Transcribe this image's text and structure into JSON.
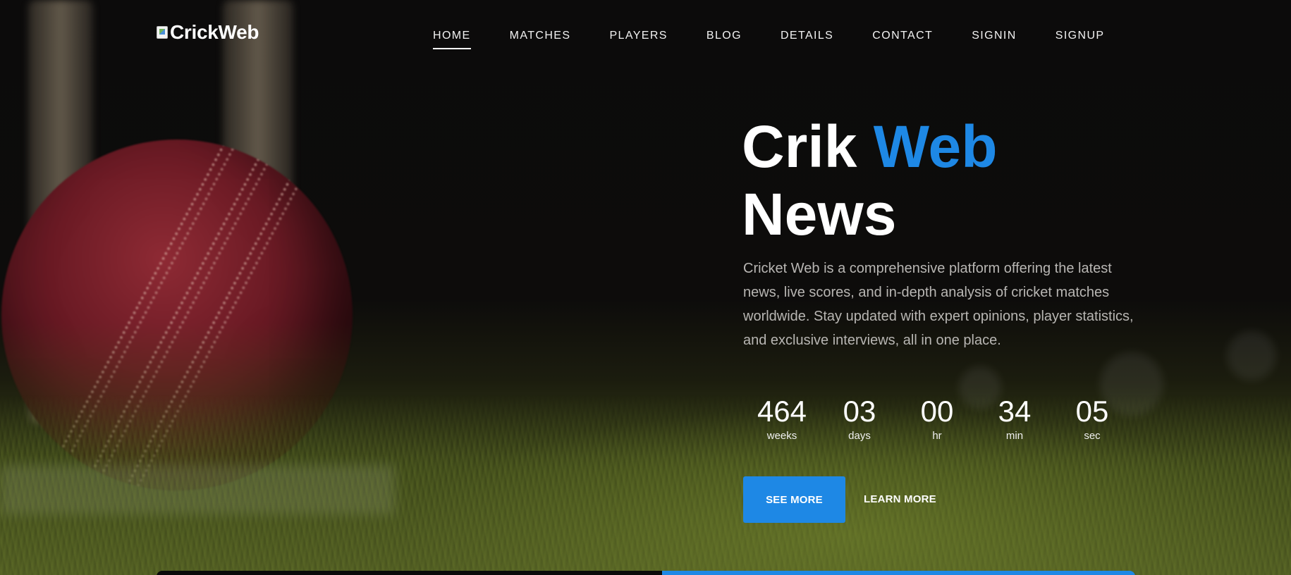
{
  "brand": {
    "logo_text": "CrickWeb"
  },
  "nav": {
    "items": [
      {
        "label": "HOME",
        "active": true
      },
      {
        "label": "MATCHES",
        "active": false
      },
      {
        "label": "PLAYERS",
        "active": false
      },
      {
        "label": "BLOG",
        "active": false
      },
      {
        "label": "DETAILS",
        "active": false
      },
      {
        "label": "CONTACT",
        "active": false
      },
      {
        "label": "SIGNIN",
        "active": false
      },
      {
        "label": "SIGNUP",
        "active": false
      }
    ]
  },
  "hero": {
    "title_part1": "Crik",
    "title_accent": "Web",
    "title_part2": "News",
    "description": "Cricket Web is a comprehensive platform offering the latest news, live scores, and in-depth analysis of cricket matches worldwide. Stay updated with expert opinions, player statistics, and exclusive interviews, all in one place.",
    "countdown": [
      {
        "value": "464",
        "label": "weeks"
      },
      {
        "value": "03",
        "label": "days"
      },
      {
        "value": "00",
        "label": "hr"
      },
      {
        "value": "34",
        "label": "min"
      },
      {
        "value": "05",
        "label": "sec"
      }
    ],
    "primary_button": "SEE MORE",
    "secondary_link": "LEARN MORE"
  },
  "colors": {
    "accent": "#1e88e5",
    "background": "#0b0a0a",
    "body_text": "#b8b6b3"
  },
  "icons": {
    "logo": "broken-image-icon"
  }
}
